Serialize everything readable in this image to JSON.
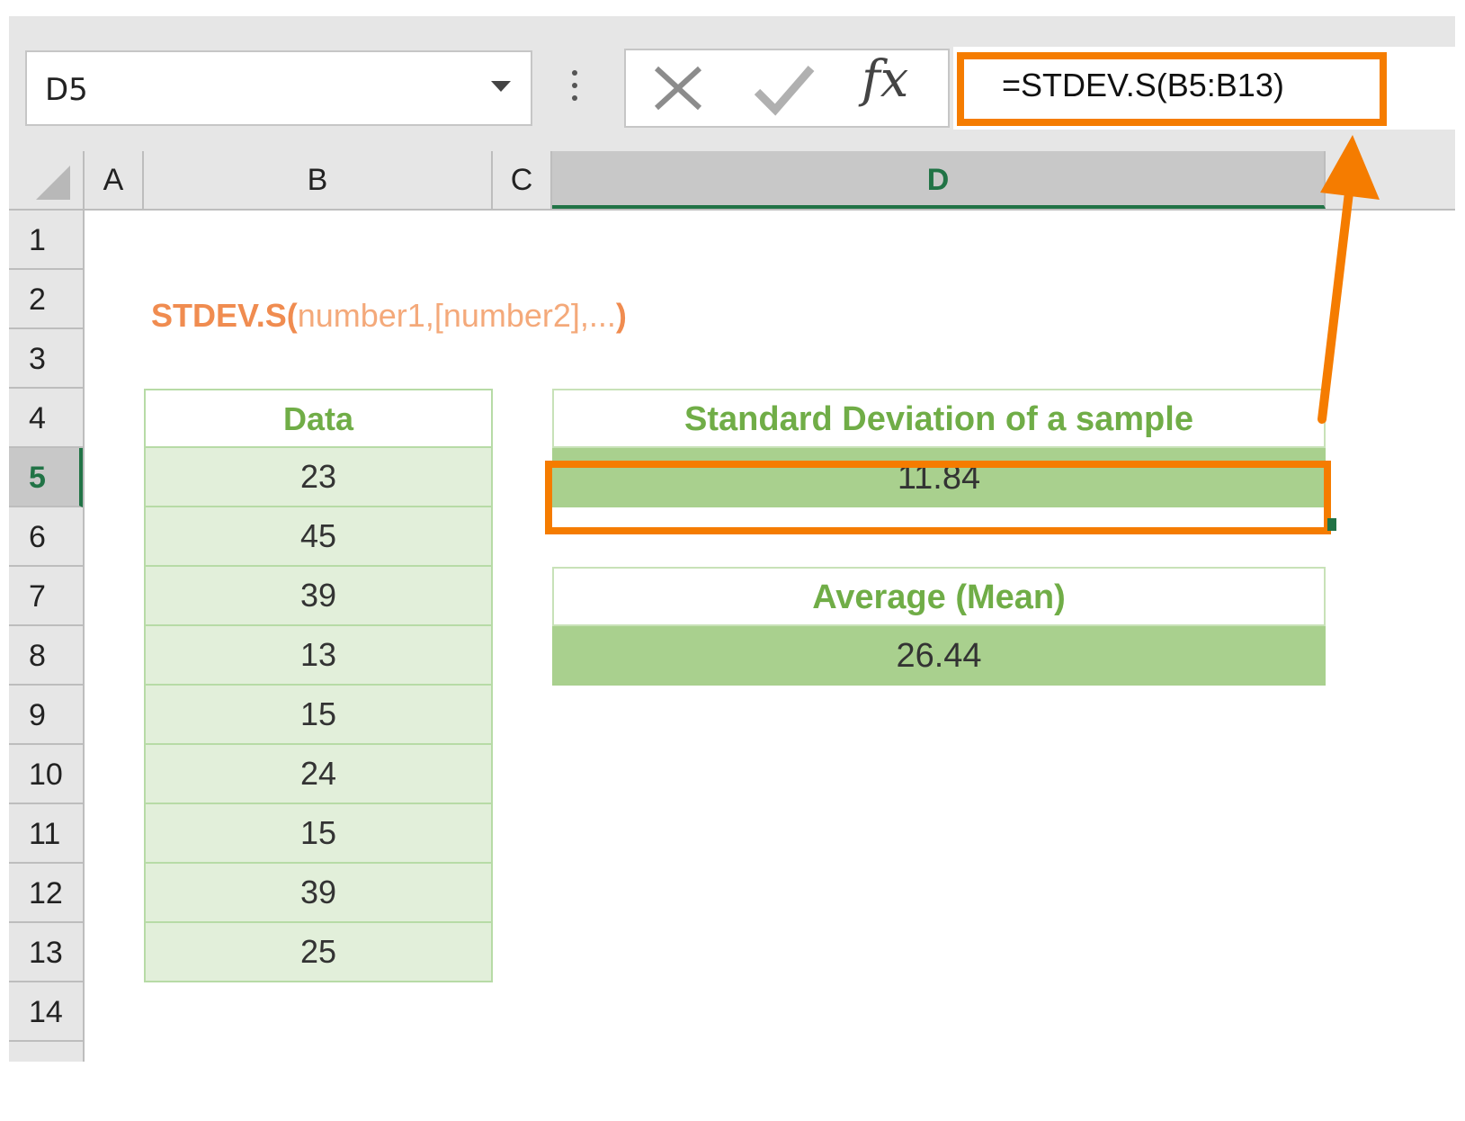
{
  "colors": {
    "accent_orange": "#f57c00",
    "excel_green": "#217346",
    "table_header_green": "#70ad47",
    "value_fill": "#a9d08e",
    "data_fill": "#e2efda"
  },
  "formula_bar": {
    "name_box": "D5",
    "cancel_icon": "close-icon",
    "enter_icon": "check-icon",
    "fx_label": "fx",
    "formula": "=STDEV.S(B5:B13)"
  },
  "columns": [
    "A",
    "B",
    "C",
    "D"
  ],
  "active_column": "D",
  "rows": [
    "1",
    "2",
    "3",
    "4",
    "5",
    "6",
    "7",
    "8",
    "9",
    "10",
    "11",
    "12",
    "13",
    "14"
  ],
  "active_row": "5",
  "syntax": {
    "function_name": "STDEV.S(",
    "arguments": "number1,[number2],...",
    "closing": ")"
  },
  "data_table": {
    "header": "Data",
    "values": [
      "23",
      "45",
      "39",
      "13",
      "15",
      "24",
      "15",
      "39",
      "25"
    ]
  },
  "std_dev": {
    "header": "Standard Deviation of a sample",
    "value": "11.84"
  },
  "average": {
    "header": "Average (Mean)",
    "value": "26.44"
  }
}
